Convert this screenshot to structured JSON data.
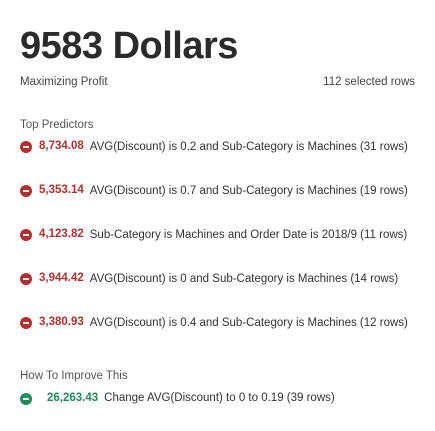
{
  "header": {
    "title": "9583 Dollars",
    "goal": "Maximizing Profit",
    "selection": "112 selected rows"
  },
  "top_predictors": {
    "label": "Top Predictors",
    "items": [
      {
        "value": "8,734.08",
        "description": "AVG(Discount) is 0.2 and Sub-Category is Machines (31 rows)"
      },
      {
        "value": "5,353.14",
        "description": "AVG(Discount) is 0.7 and Sub-Category is Machines (19 rows)"
      },
      {
        "value": "4,123.82",
        "description": "Sub-Category is Machines and Order Date is 2018/9 (11 rows)"
      },
      {
        "value": "3,944.42",
        "description": "AVG(Discount) is 0 and Sub-Category is Machines (14 rows)"
      },
      {
        "value": "3,380.93",
        "description": "AVG(Discount) is 0.4 and Sub-Category is Machines (12 rows)"
      }
    ],
    "icon": "minus-circle-icon",
    "color": "#b03030"
  },
  "improve": {
    "label": "How To Improve This",
    "value": "26,263.43",
    "description": "Change AVG(Discount) to 0 to 0.19 (39 rows)",
    "icon": "minus-circle-icon",
    "color": "#1f8a5b"
  }
}
